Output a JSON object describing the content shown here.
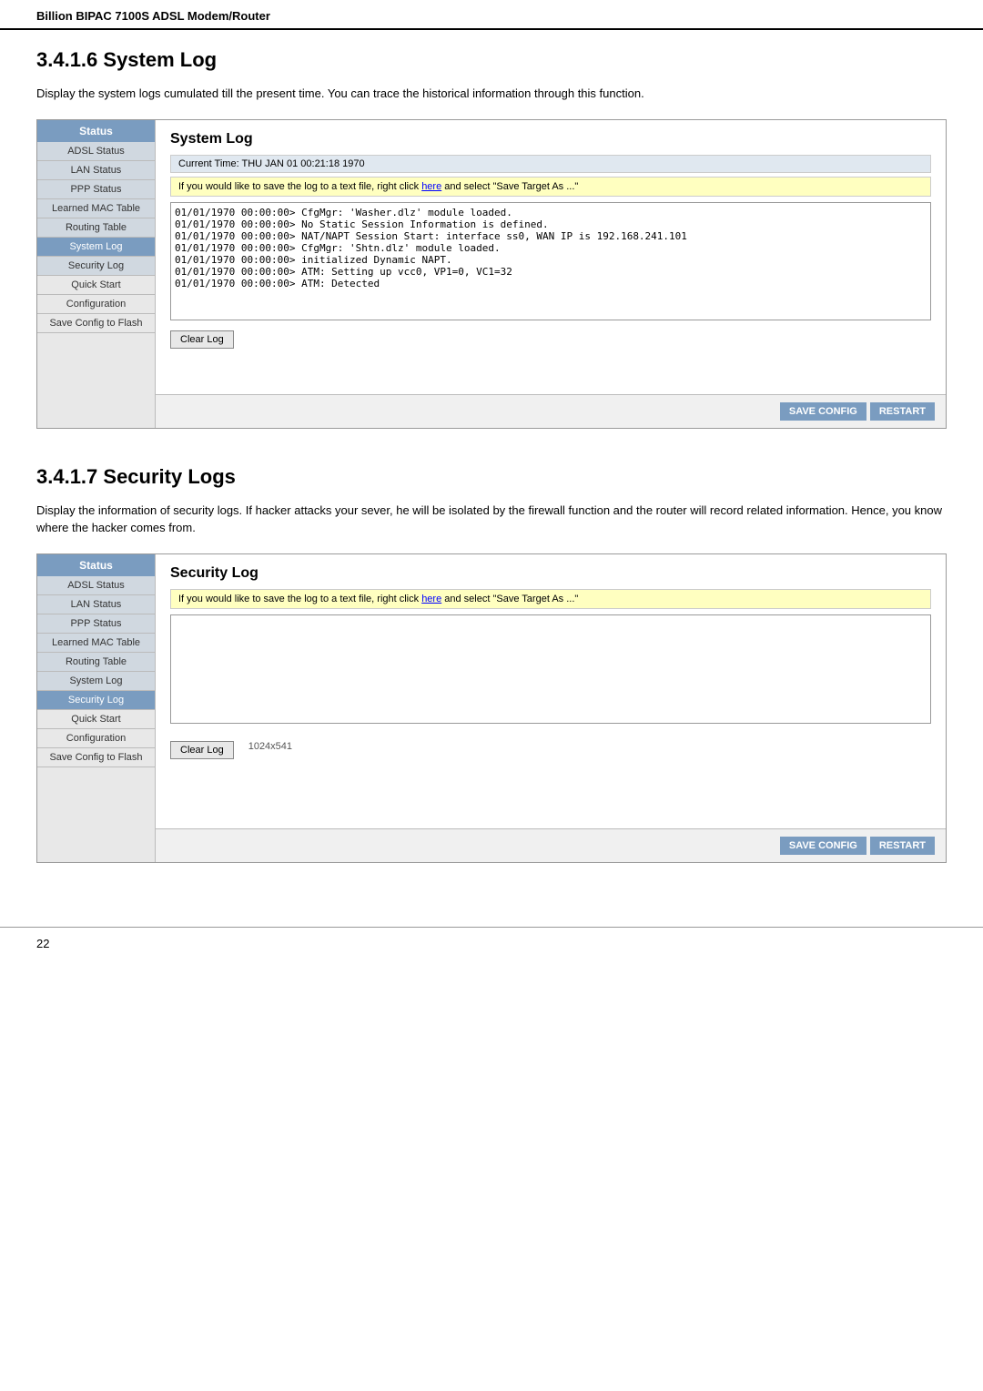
{
  "page": {
    "header": "Billion BIPAC 7100S ADSL Modem/Router",
    "footer_page": "22"
  },
  "system_log_section": {
    "title": "3.4.1.6 System Log",
    "description": "Display the system logs cumulated till the present time. You can trace the historical information through this function.",
    "panel_title": "System Log",
    "current_time_label": "Current Time: THU JAN 01 00:21:18 1970",
    "info_text_prefix": "If you would like to save the log to a text file, right click ",
    "info_link": "here",
    "info_text_suffix": " and select \"Save Target As ...\"",
    "log_content": "01/01/1970 00:00:00> CfgMgr: 'Washer.dlz' module loaded.\n01/01/1970 00:00:00> No Static Session Information is defined.\n01/01/1970 00:00:00> NAT/NAPT Session Start: interface ss0, WAN IP is 192.168.241.101\n01/01/1970 00:00:00> CfgMgr: 'Shtn.dlz' module loaded.\n01/01/1970 00:00:00> initialized Dynamic NAPT.\n01/01/1970 00:00:00> ATM: Setting up vcc0, VP1=0, VC1=32\n01/01/1970 00:00:00> ATM: Detected",
    "clear_log_btn": "Clear Log",
    "save_config_btn": "SAVE CONFIG",
    "restart_btn": "RESTART",
    "sidebar": {
      "header": "Status",
      "items": [
        {
          "label": "ADSL Status",
          "active": false
        },
        {
          "label": "LAN Status",
          "active": false
        },
        {
          "label": "PPP Status",
          "active": false
        },
        {
          "label": "Learned MAC Table",
          "active": false
        },
        {
          "label": "Routing Table",
          "active": false
        },
        {
          "label": "System Log",
          "active": true
        },
        {
          "label": "Security Log",
          "active": false
        },
        {
          "label": "Quick Start",
          "plain": true
        },
        {
          "label": "Configuration",
          "plain": true
        },
        {
          "label": "Save Config to Flash",
          "plain": true
        }
      ]
    }
  },
  "security_log_section": {
    "title": "3.4.1.7 Security Logs",
    "description": "Display the information of security logs. If hacker attacks your sever, he will be isolated by the firewall function and the router will record related information. Hence, you know where the hacker comes from.",
    "panel_title": "Security Log",
    "info_text_prefix": "If you would like to save the log to a text file, right click ",
    "info_link": "here",
    "info_text_suffix": " and select \"Save Target As ...\"",
    "log_content": "",
    "image_size_label": "1024x541",
    "clear_log_btn": "Clear Log",
    "save_config_btn": "SAVE CONFIG",
    "restart_btn": "RESTART",
    "sidebar": {
      "header": "Status",
      "items": [
        {
          "label": "ADSL Status",
          "active": false
        },
        {
          "label": "LAN Status",
          "active": false
        },
        {
          "label": "PPP Status",
          "active": false
        },
        {
          "label": "Learned MAC Table",
          "active": false
        },
        {
          "label": "Routing Table",
          "active": false
        },
        {
          "label": "System Log",
          "active": false
        },
        {
          "label": "Security Log",
          "active": true
        },
        {
          "label": "Quick Start",
          "plain": true
        },
        {
          "label": "Configuration",
          "plain": true
        },
        {
          "label": "Save Config to Flash",
          "plain": true
        }
      ]
    }
  }
}
